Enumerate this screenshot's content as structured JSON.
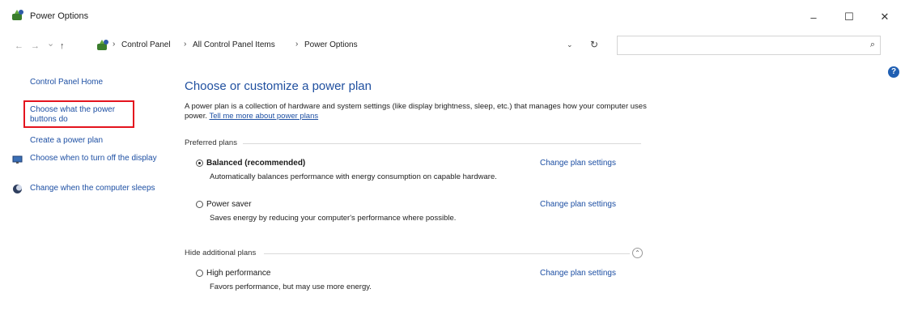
{
  "window": {
    "title": "Power Options",
    "icon": "power-options-icon",
    "controls": {
      "minimize": "–",
      "maximize": "☐",
      "close": "✕"
    }
  },
  "nav": {
    "back_icon": "←",
    "forward_icon": "→",
    "recent_icon": "⌄",
    "up_icon": "↑",
    "breadcrumbs": [
      "Control Panel",
      "All Control Panel Items",
      "Power Options"
    ],
    "separator": "›",
    "dropdown_icon": "⌄",
    "refresh_icon": "↻",
    "search_placeholder": "",
    "search_icon": "⌕"
  },
  "help_icon": "?",
  "left_pane": {
    "home": "Control Panel Home",
    "items": [
      {
        "label": "Choose what the power buttons do"
      },
      {
        "label": "Create a power plan"
      },
      {
        "label": "Choose when to turn off the display",
        "icon": "display-icon"
      },
      {
        "label": "Change when the computer sleeps",
        "icon": "sleep-icon"
      }
    ]
  },
  "main": {
    "title": "Choose or customize a power plan",
    "description": "A power plan is a collection of hardware and system settings (like display brightness, sleep, etc.) that manages how your computer uses power.",
    "learn_more": "Tell me more about power plans",
    "preferred_label": "Preferred plans",
    "hide_label": "Hide additional plans",
    "collapse_icon": "⌃",
    "plans": [
      {
        "name": "Balanced (recommended)",
        "desc": "Automatically balances performance with energy consumption on capable hardware.",
        "link": "Change plan settings",
        "selected": true
      },
      {
        "name": "Power saver",
        "desc": "Saves energy by reducing your computer's performance where possible.",
        "link": "Change plan settings",
        "selected": false
      },
      {
        "name": "High performance",
        "desc": "Favors performance, but may use more energy.",
        "link": "Change plan settings",
        "selected": false
      }
    ]
  },
  "colors": {
    "link": "#1d4fa3",
    "title": "#1f4f9f",
    "highlight": "#e4141e"
  }
}
